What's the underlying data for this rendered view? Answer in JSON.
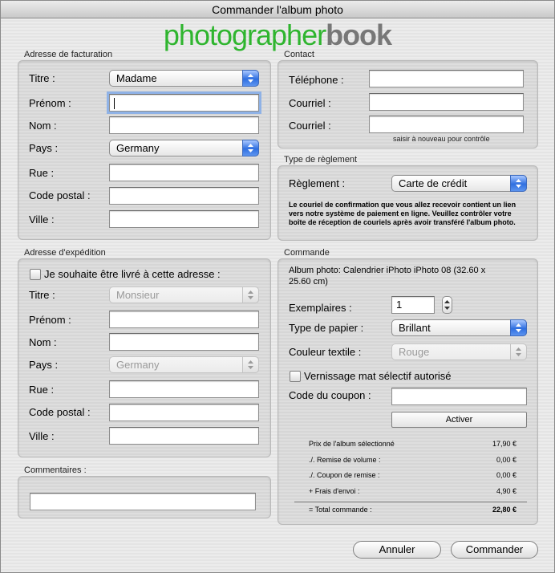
{
  "window": {
    "title": "Commander l'album photo"
  },
  "logo": {
    "part1": "photographer",
    "part2": "book"
  },
  "billing": {
    "section": "Adresse de facturation",
    "titre_label": "Titre :",
    "titre_value": "Madame",
    "prenom_label": "Prénom :",
    "nom_label": "Nom :",
    "pays_label": "Pays :",
    "pays_value": "Germany",
    "rue_label": "Rue :",
    "cp_label": "Code postal :",
    "ville_label": "Ville :"
  },
  "contact": {
    "section": "Contact",
    "tel_label": "Téléphone :",
    "email_label": "Courriel :",
    "email2_label": "Courriel :",
    "hint": "saisir à nouveau pour contrôle"
  },
  "payment": {
    "section": "Type de règlement",
    "label": "Règlement :",
    "value": "Carte de crédit",
    "note": "Le couriel de confirmation que vous allez recevoir contient un lien vers notre système de paiement en ligne. Veuillez contrôler votre boîte de réception de couriels après avoir transféré l'album photo."
  },
  "shipping": {
    "section": "Adresse d'expédition",
    "checkbox_label": "Je souhaite être livré à cette adresse :",
    "titre_label": "Titre :",
    "titre_value": "Monsieur",
    "prenom_label": "Prénom :",
    "nom_label": "Nom :",
    "pays_label": "Pays :",
    "pays_value": "Germany",
    "rue_label": "Rue :",
    "cp_label": "Code postal :",
    "ville_label": "Ville :"
  },
  "comments": {
    "section": "Commentaires :"
  },
  "order": {
    "section": "Commande",
    "album_line1": "Album photo: Calendrier iPhoto iPhoto 08 (32.60 x",
    "album_line2": "25.60 cm)",
    "copies_label": "Exemplaires :",
    "copies_value": "1",
    "paper_label": "Type de papier :",
    "paper_value": "Brillant",
    "textile_label": "Couleur textile :",
    "textile_value": "Rouge",
    "varnish_label": "Vernissage mat sélectif autorisé",
    "coupon_label": "Code du coupon :",
    "activate_label": "Activer",
    "summary": [
      {
        "label": "Prix de l'album sélectionné",
        "value": "17,90 €"
      },
      {
        "label": "./. Remise de volume :",
        "value": "0,00 €"
      },
      {
        "label": "./. Coupon de remise :",
        "value": "0,00 €"
      },
      {
        "label": "+ Frais d'envoi :",
        "value": "4,90 €"
      }
    ],
    "total_label": "= Total commande :",
    "total_value": "22,80 €"
  },
  "footer": {
    "cancel_label": "Annuler",
    "order_label": "Commander"
  },
  "colors": {
    "accent": "#2f6fe0",
    "logo_green": "#2fb52f",
    "logo_gray": "#777777"
  }
}
